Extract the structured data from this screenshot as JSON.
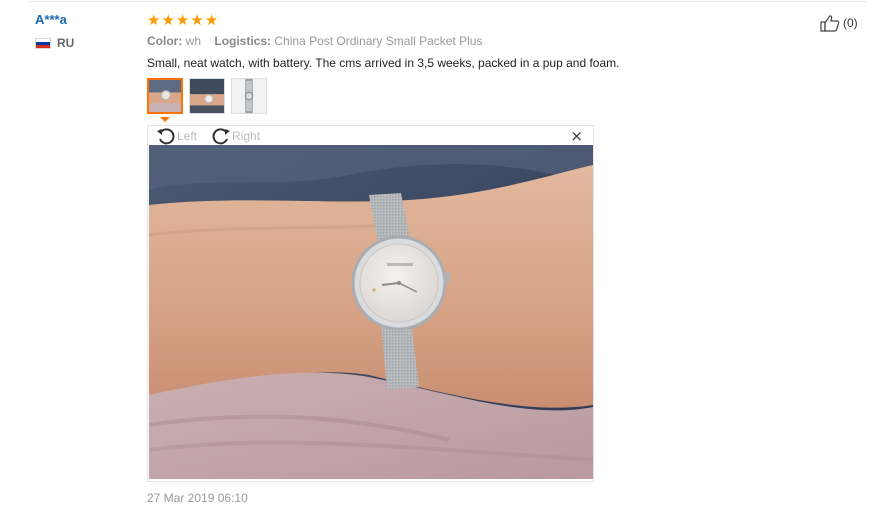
{
  "review": {
    "user_name": "A***a",
    "country_code": "RU",
    "flag_colors": [
      "#ffffff",
      "#0039a6",
      "#d52b1e"
    ],
    "rating": 5,
    "star_color": "#ff9a00",
    "attributes": [
      {
        "label": "Color:",
        "value": "wh"
      },
      {
        "label": "Logistics:",
        "value": "China Post Ordinary Small Packet Plus"
      }
    ],
    "feedback": "Small, neat watch, with battery. The cms arrived in 3,5 weeks, packed in a pup and foam.",
    "thumbnails": [
      {
        "name": "photo-thumb-1",
        "active": true
      },
      {
        "name": "photo-thumb-2",
        "active": false
      },
      {
        "name": "photo-thumb-3",
        "active": false
      }
    ],
    "viewer": {
      "rotate_left_label": "Left",
      "rotate_right_label": "Right",
      "close_glyph": "×"
    },
    "date": "27 Mar 2019 06:10",
    "helpful_count": "(0)",
    "accent_color": "#ff7300",
    "username_color": "#1d67b5"
  }
}
